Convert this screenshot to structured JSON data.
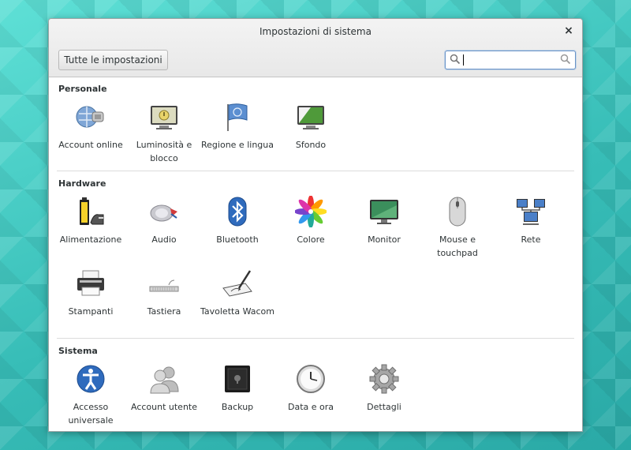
{
  "window": {
    "title": "Impostazioni di sistema",
    "close_glyph": "×"
  },
  "toolbar": {
    "all_settings_label": "Tutte le impostazioni",
    "search_value": ""
  },
  "sections": [
    {
      "title": "Personale",
      "items": [
        {
          "label": "Account online",
          "icon": "online-accounts-icon"
        },
        {
          "label": "Luminosità e blocco",
          "icon": "brightness-lock-icon"
        },
        {
          "label": "Regione e lingua",
          "icon": "region-language-flag-icon"
        },
        {
          "label": "Sfondo",
          "icon": "background-icon"
        }
      ]
    },
    {
      "title": "Hardware",
      "items": [
        {
          "label": "Alimentazione",
          "icon": "power-battery-icon"
        },
        {
          "label": "Audio",
          "icon": "audio-icon"
        },
        {
          "label": "Bluetooth",
          "icon": "bluetooth-icon"
        },
        {
          "label": "Colore",
          "icon": "color-icon"
        },
        {
          "label": "Monitor",
          "icon": "monitor-icon"
        },
        {
          "label": "Mouse e touchpad",
          "icon": "mouse-icon"
        },
        {
          "label": "Rete",
          "icon": "network-icon"
        },
        {
          "label": "Stampanti",
          "icon": "printer-icon"
        },
        {
          "label": "Tastiera",
          "icon": "keyboard-icon"
        },
        {
          "label": "Tavoletta Wacom",
          "icon": "wacom-tablet-icon"
        }
      ]
    },
    {
      "title": "Sistema",
      "items": [
        {
          "label": "Accesso universale",
          "icon": "universal-access-icon"
        },
        {
          "label": "Account utente",
          "icon": "user-accounts-icon"
        },
        {
          "label": "Backup",
          "icon": "backup-safe-icon"
        },
        {
          "label": "Data e ora",
          "icon": "clock-icon"
        },
        {
          "label": "Dettagli",
          "icon": "details-gear-icon"
        }
      ]
    }
  ]
}
